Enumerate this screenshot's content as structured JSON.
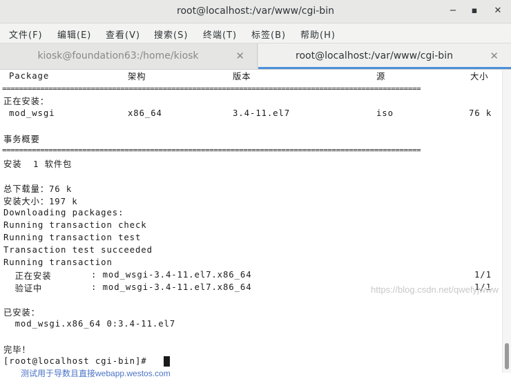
{
  "window": {
    "title": "root@localhost:/var/www/cgi-bin",
    "minimize": "−",
    "maximize": "▪",
    "close": "✕"
  },
  "menu": [
    "文件(F)",
    "编辑(E)",
    "查看(V)",
    "搜索(S)",
    "终端(T)",
    "标签(B)",
    "帮助(H)"
  ],
  "tabs": [
    {
      "label": "kiosk@foundation63:/home/kiosk",
      "close": "✕"
    },
    {
      "label": "root@localhost:/var/www/cgi-bin",
      "close": "✕"
    }
  ],
  "terminal": {
    "header": {
      "package": "Package",
      "arch": "架构",
      "version": "版本",
      "repo": "源",
      "size": "大小"
    },
    "separator": "===================================================================================================",
    "installing_label": "正在安装：",
    "pkg_row": {
      "name": "mod_wsgi",
      "arch": "x86_64",
      "version": "3.4-11.el7",
      "repo": "iso",
      "size": "76 k"
    },
    "summary_label": "事务概要",
    "install_count": "安装  1 软件包",
    "total_download": "总下载量：76 k",
    "installed_size": "安装大小：197 k",
    "lines": [
      "Downloading packages:",
      "Running transaction check",
      "Running transaction test",
      "Transaction test succeeded",
      "Running transaction"
    ],
    "step1": {
      "label": "  正在安装    ",
      "text": ": mod_wsgi-3.4-11.el7.x86_64",
      "count": "1/1"
    },
    "step2": {
      "label": "  验证中      ",
      "text": ": mod_wsgi-3.4-11.el7.x86_64",
      "count": "1/1"
    },
    "installed_label": "已安装：",
    "installed_pkg": "  mod_wsgi.x86_64 0:3.4-11.el7",
    "done": "完毕！",
    "prompt": "[root@localhost cgi-bin]# "
  },
  "watermark": "https://blog.csdn.net/qwefyjwww",
  "bottom_strip_text": "测试用于导数且直接webapp.westos.com"
}
